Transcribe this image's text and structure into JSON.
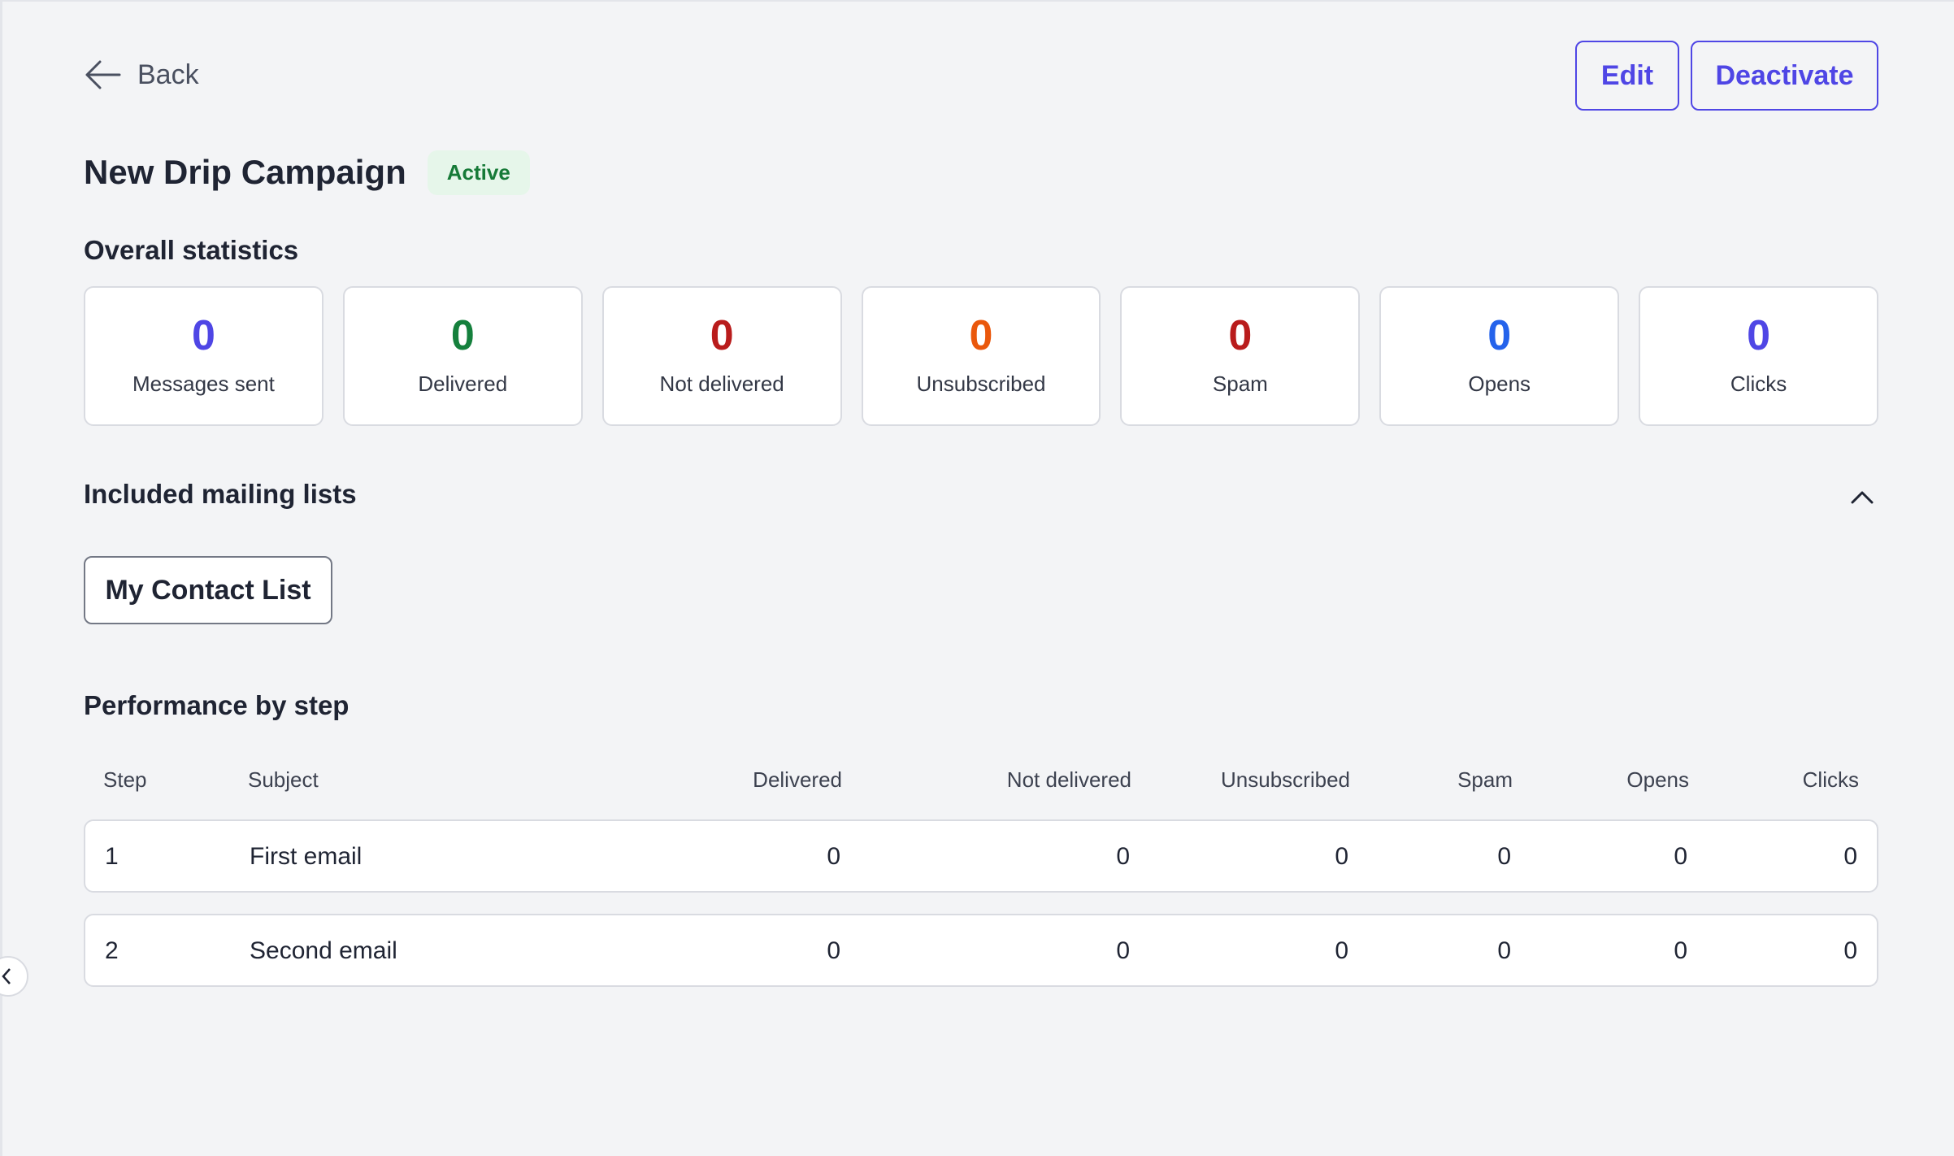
{
  "header": {
    "back_label": "Back",
    "edit_label": "Edit",
    "deactivate_label": "Deactivate"
  },
  "campaign": {
    "title": "New Drip Campaign",
    "status": "Active"
  },
  "overall": {
    "heading": "Overall statistics",
    "stats": [
      {
        "value": "0",
        "label": "Messages sent",
        "color": "#4f46e5"
      },
      {
        "value": "0",
        "label": "Delivered",
        "color": "#15803d"
      },
      {
        "value": "0",
        "label": "Not delivered",
        "color": "#b91c1c"
      },
      {
        "value": "0",
        "label": "Unsubscribed",
        "color": "#ea580c"
      },
      {
        "value": "0",
        "label": "Spam",
        "color": "#b91c1c"
      },
      {
        "value": "0",
        "label": "Opens",
        "color": "#2563eb"
      },
      {
        "value": "0",
        "label": "Clicks",
        "color": "#4f46e5"
      }
    ]
  },
  "mailing_lists": {
    "heading": "Included mailing lists",
    "items": [
      "My Contact List"
    ]
  },
  "performance": {
    "heading": "Performance by step",
    "columns": [
      "Step",
      "Subject",
      "Delivered",
      "Not delivered",
      "Unsubscribed",
      "Spam",
      "Opens",
      "Clicks"
    ],
    "rows": [
      {
        "step": "1",
        "subject": "First email",
        "delivered": "0",
        "not_delivered": "0",
        "unsubscribed": "0",
        "spam": "0",
        "opens": "0",
        "clicks": "0"
      },
      {
        "step": "2",
        "subject": "Second email",
        "delivered": "0",
        "not_delivered": "0",
        "unsubscribed": "0",
        "spam": "0",
        "opens": "0",
        "clicks": "0"
      }
    ]
  },
  "icons": {
    "back": "arrow-left-icon",
    "collapse": "chevron-up-icon",
    "sidebar_toggle": "chevron-left-icon"
  }
}
